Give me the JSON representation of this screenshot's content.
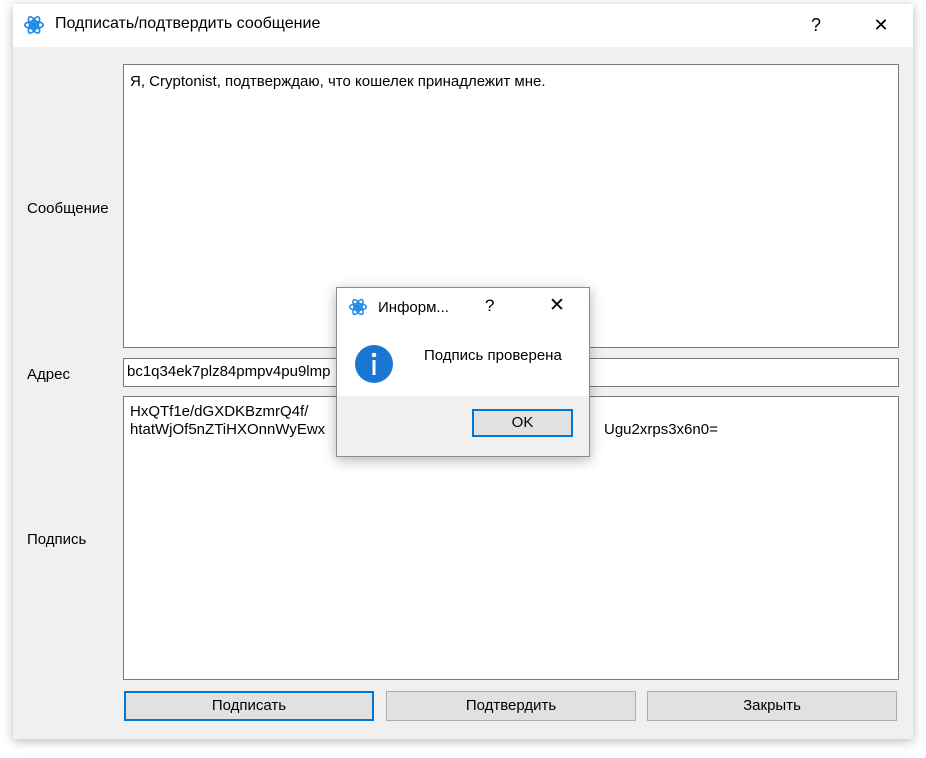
{
  "window": {
    "title": "Подписать/подтвердить сообщение",
    "help_glyph": "?",
    "close_glyph": "✕",
    "icon": "app-logo-icon"
  },
  "form": {
    "message_label": "Сообщение",
    "message_value": "Я, Cryptonist, подтверждаю, что кошелек принадлежит мне.",
    "address_label": "Адрес",
    "address_value": "bc1q34ek7plz84pmpv4pu9lmp",
    "signature_label": "Подпись",
    "signature_line1": "HxQTf1e/dGXDKBzmrQ4f/",
    "signature_line2_start": "htatWjOf5nZTiHXOnnWyEwx",
    "signature_line2_end": "Ugu2xrps3x6n0="
  },
  "buttons": {
    "sign": "Подписать",
    "verify": "Подтвердить",
    "close": "Закрыть"
  },
  "dialog": {
    "title": "Информ...",
    "help_glyph": "?",
    "close_glyph": "✕",
    "icon": "info-icon",
    "message": "Подпись проверена",
    "ok_label": "OK"
  },
  "colors": {
    "accent": "#0078d7",
    "window_bg": "#f0f0f0",
    "button_bg": "#e1e1e1"
  }
}
